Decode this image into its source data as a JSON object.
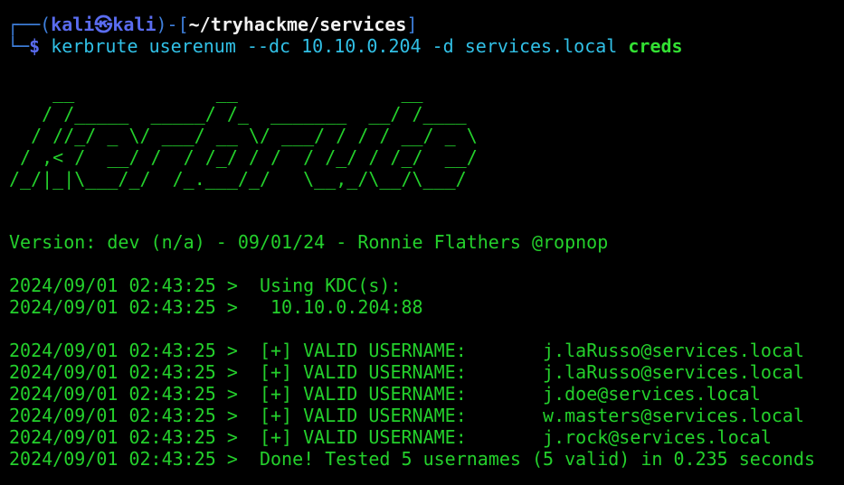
{
  "prompt": {
    "frame_left": "┌──(",
    "user": "kali",
    "skull": "㉿",
    "host": "kali",
    "frame_mid": ")-[",
    "path": "~/tryhackme/services",
    "frame_right": "]",
    "line2_frame": "└─",
    "dollar": "$"
  },
  "command": {
    "name": "kerbrute",
    "args": "userenum --dc 10.10.0.204 -d services.local",
    "last_arg": "creds"
  },
  "banner": "    __             __               __     \n   / /_____  _____/ /_  _______  __/ /____ \n  / //_/ _ \\/ ___/ __ \\/ ___/ / / / __/ _ \\\n / ,< /  __/ /  / /_/ / /  / /_/ / /_/  __/\n/_/|_|\\___/_/  /_.___/_/   \\__,_/\\__/\\___/ ",
  "version_line": "Version: dev (n/a) - 09/01/24 - Ronnie Flathers @ropnop",
  "log": [
    {
      "ts": "2024/09/01 02:43:25 >",
      "msg": "  Using KDC(s):"
    },
    {
      "ts": "2024/09/01 02:43:25 >",
      "msg": "   10.10.0.204:88"
    },
    {
      "ts": "2024/09/01 02:43:25 >",
      "msg": "  [+] VALID USERNAME:       j.laRusso@services.local"
    },
    {
      "ts": "2024/09/01 02:43:25 >",
      "msg": "  [+] VALID USERNAME:       j.laRusso@services.local"
    },
    {
      "ts": "2024/09/01 02:43:25 >",
      "msg": "  [+] VALID USERNAME:       j.doe@services.local"
    },
    {
      "ts": "2024/09/01 02:43:25 >",
      "msg": "  [+] VALID USERNAME:       w.masters@services.local"
    },
    {
      "ts": "2024/09/01 02:43:25 >",
      "msg": "  [+] VALID USERNAME:       j.rock@services.local"
    },
    {
      "ts": "2024/09/01 02:43:25 >",
      "msg": "  Done! Tested 5 usernames (5 valid) in 0.235 seconds"
    }
  ],
  "colors": {
    "background": "#000000",
    "output_green": "#24d02c",
    "prompt_blue": "#5a6cf0",
    "command_cyan": "#31c0e6"
  }
}
